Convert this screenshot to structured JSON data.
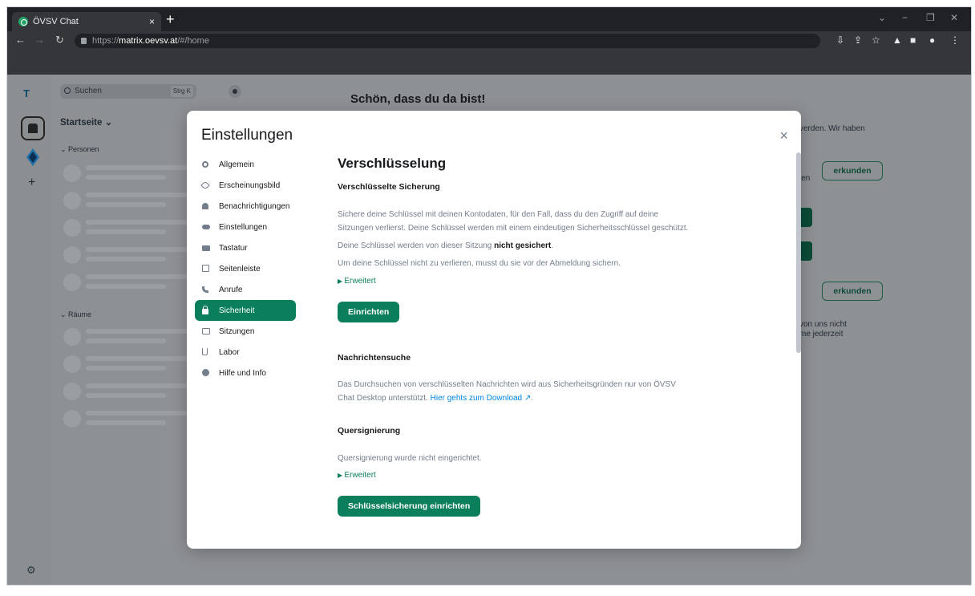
{
  "browser": {
    "tab_title": "ÖVSV Chat",
    "tab_close": "×",
    "new_tab": "+",
    "url_scheme": "https://",
    "url_host": "matrix.oevsv.at",
    "url_path": "/#/home",
    "win_min": "−",
    "win_restore": "❐",
    "win_close": "✕",
    "win_chevron": "⌄"
  },
  "sidebar": {
    "space_initial": "T",
    "add": "+",
    "settings_icon": "⚙"
  },
  "roomlist": {
    "search_placeholder": "Suchen",
    "search_shortcut": "Strg K",
    "home_title": "Startseite ⌄",
    "section_people": "Personen",
    "section_rooms": "Räume"
  },
  "main": {
    "welcome": "Schön, dass du da bist!",
    "bg_text_1": "verden. Wir haben",
    "bg_text_2": "len",
    "bg_text_3": "von uns nicht",
    "bg_text_4": "me jederzeit",
    "explore_label": "erkunden"
  },
  "modal": {
    "title": "Einstellungen",
    "close": "×",
    "nav": [
      {
        "label": "Allgemein"
      },
      {
        "label": "Erscheinungsbild"
      },
      {
        "label": "Benachrichtigungen"
      },
      {
        "label": "Einstellungen"
      },
      {
        "label": "Tastatur"
      },
      {
        "label": "Seitenleiste"
      },
      {
        "label": "Anrufe"
      },
      {
        "label": "Sicherheit"
      },
      {
        "label": "Sitzungen"
      },
      {
        "label": "Labor"
      },
      {
        "label": "Hilfe und Info"
      }
    ],
    "content": {
      "heading": "Verschlüsselung",
      "backup_heading": "Verschlüsselte Sicherung",
      "backup_desc_1": "Sichere deine Schlüssel mit deinen Kontodaten, für den Fall, dass du den Zugriff auf deine",
      "backup_desc_2": "Sitzungen verlierst. Deine Schlüssel werden mit einem eindeutigen Sicherheitsschlüssel geschützt.",
      "backup_status_prefix": "Deine Schlüssel werden von dieser Sitzung ",
      "backup_status_bold": "nicht gesichert",
      "backup_status_suffix": ".",
      "backup_hint": "Um deine Schlüssel nicht zu verlieren, musst du sie vor der Abmeldung sichern.",
      "advanced_1": "Erweitert",
      "setup_button": "Einrichten",
      "search_heading": "Nachrichtensuche",
      "search_desc_1": "Das Durchsuchen von verschlüsselten Nachrichten wird aus Sicherheitsgründen nur von ÖVSV",
      "search_desc_2": "Chat Desktop unterstützt.",
      "search_link": "Hier gehts zum Download ↗",
      "search_desc_end": ".",
      "cross_heading": "Quersignierung",
      "cross_desc": "Quersignierung wurde nicht eingerichtet.",
      "advanced_2": "Erweitert",
      "key_backup_button": "Schlüsselsicherung einrichten"
    }
  },
  "colors": {
    "accent": "#0b7e5b",
    "link": "#0086e6",
    "muted_text": "#737d8c",
    "overlay": "#8e9194"
  }
}
